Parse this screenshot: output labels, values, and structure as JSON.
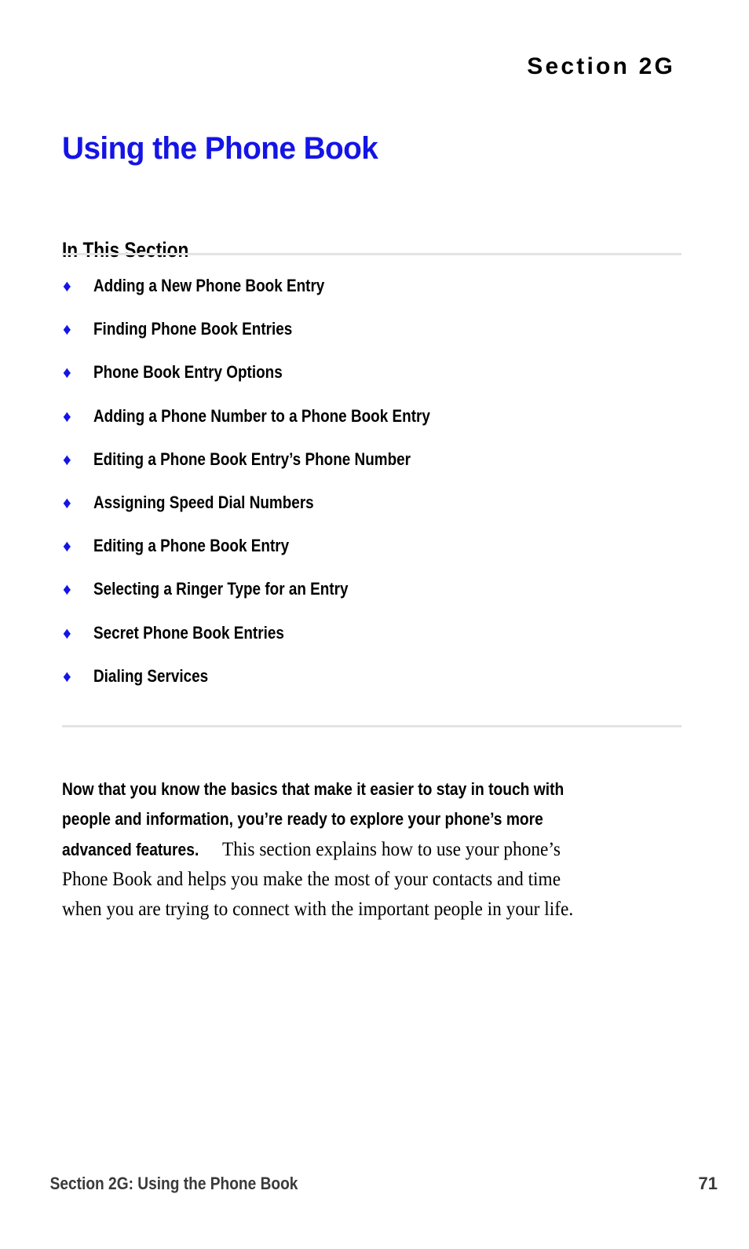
{
  "page": {
    "section_eyebrow": "Section 2G",
    "chapter_title": "Using the Phone Book",
    "background_color": "#FFFFFF",
    "accent_color": "#1414E6",
    "rule_color": "#E3E3E3",
    "footer_text_color": "#3A3A3A"
  },
  "in_this_section": {
    "heading": "In This Section",
    "bullet_glyph": "♦",
    "items": [
      {
        "label": "Adding a New Phone Book Entry"
      },
      {
        "label": "Finding Phone Book Entries"
      },
      {
        "label": "Phone Book Entry Options"
      },
      {
        "label": "Adding a Phone Number to a Phone Book Entry"
      },
      {
        "label": "Editing a Phone Book Entry’s Phone Number"
      },
      {
        "label": "Assigning Speed Dial Numbers"
      },
      {
        "label": "Editing a Phone Book Entry"
      },
      {
        "label": "Selecting a Ringer Type for an Entry"
      },
      {
        "label": "Secret Phone Book Entries"
      },
      {
        "label": "Dialing Services"
      }
    ]
  },
  "intro": {
    "line1_bold": "Now that you know the basics that make it easier to stay in touch with",
    "line2_bold": "people and information, you’re ready to explore your phone’s more",
    "line3_bold": "advanced features.",
    "line3_serif": " This section explains how to use your phone’s",
    "line4_serif": "Phone Book and helps you make the most of your contacts and time",
    "line5_serif": "when you are trying to connect with the important people in your life."
  },
  "footer": {
    "left": "Section 2G: Using the Phone Book",
    "page_number": "71"
  }
}
